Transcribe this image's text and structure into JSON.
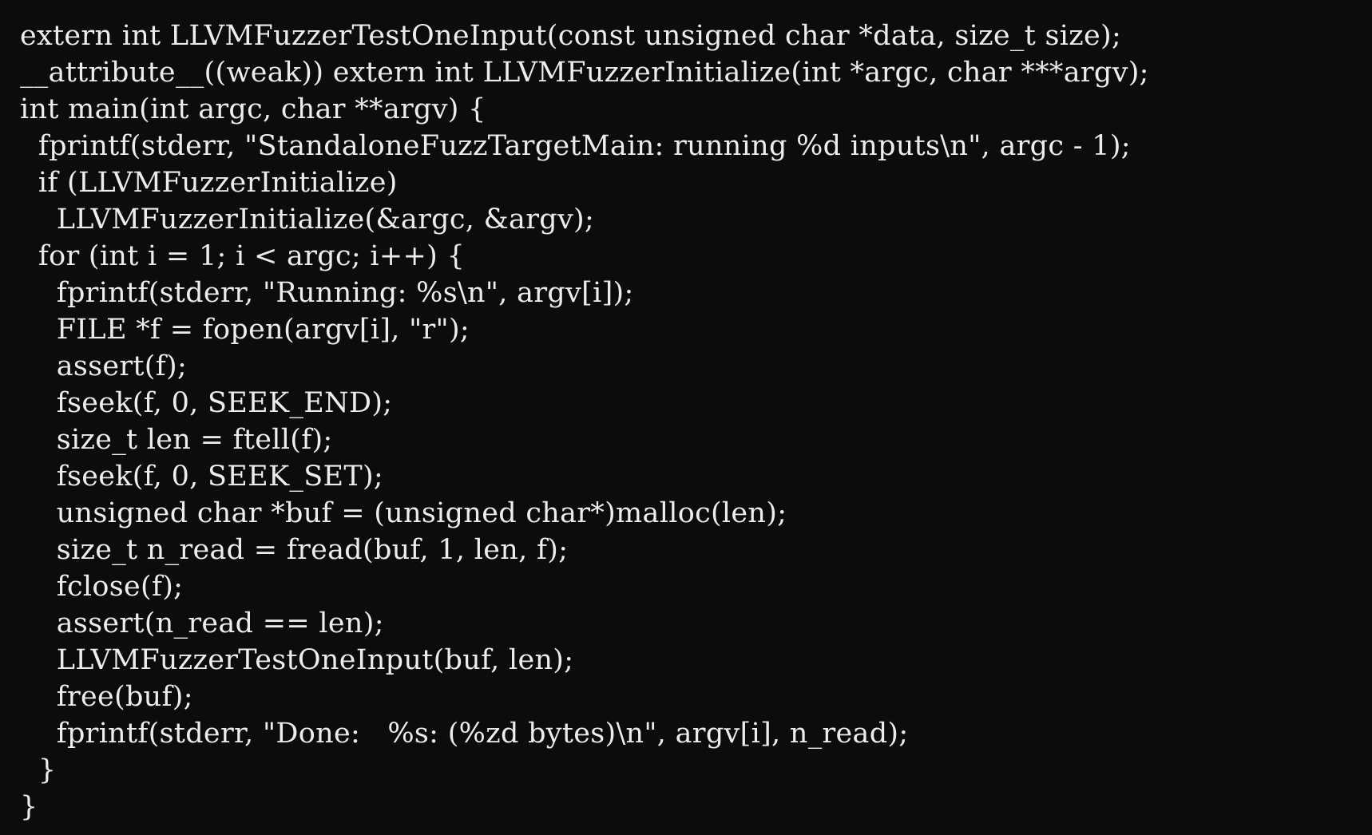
{
  "source_code": {
    "lines": [
      "extern int LLVMFuzzerTestOneInput(const unsigned char *data, size_t size);",
      "__attribute__((weak)) extern int LLVMFuzzerInitialize(int *argc, char ***argv);",
      "int main(int argc, char **argv) {",
      "  fprintf(stderr, \"StandaloneFuzzTargetMain: running %d inputs\\n\", argc - 1);",
      "  if (LLVMFuzzerInitialize)",
      "    LLVMFuzzerInitialize(&argc, &argv);",
      "  for (int i = 1; i < argc; i++) {",
      "    fprintf(stderr, \"Running: %s\\n\", argv[i]);",
      "    FILE *f = fopen(argv[i], \"r\");",
      "    assert(f);",
      "    fseek(f, 0, SEEK_END);",
      "    size_t len = ftell(f);",
      "    fseek(f, 0, SEEK_SET);",
      "    unsigned char *buf = (unsigned char*)malloc(len);",
      "    size_t n_read = fread(buf, 1, len, f);",
      "    fclose(f);",
      "    assert(n_read == len);",
      "    LLVMFuzzerTestOneInput(buf, len);",
      "    free(buf);",
      "    fprintf(stderr, \"Done:   %s: (%zd bytes)\\n\", argv[i], n_read);",
      "  }",
      "}"
    ]
  },
  "colors": {
    "background": "#0c0c0c",
    "text": "#ededed"
  }
}
